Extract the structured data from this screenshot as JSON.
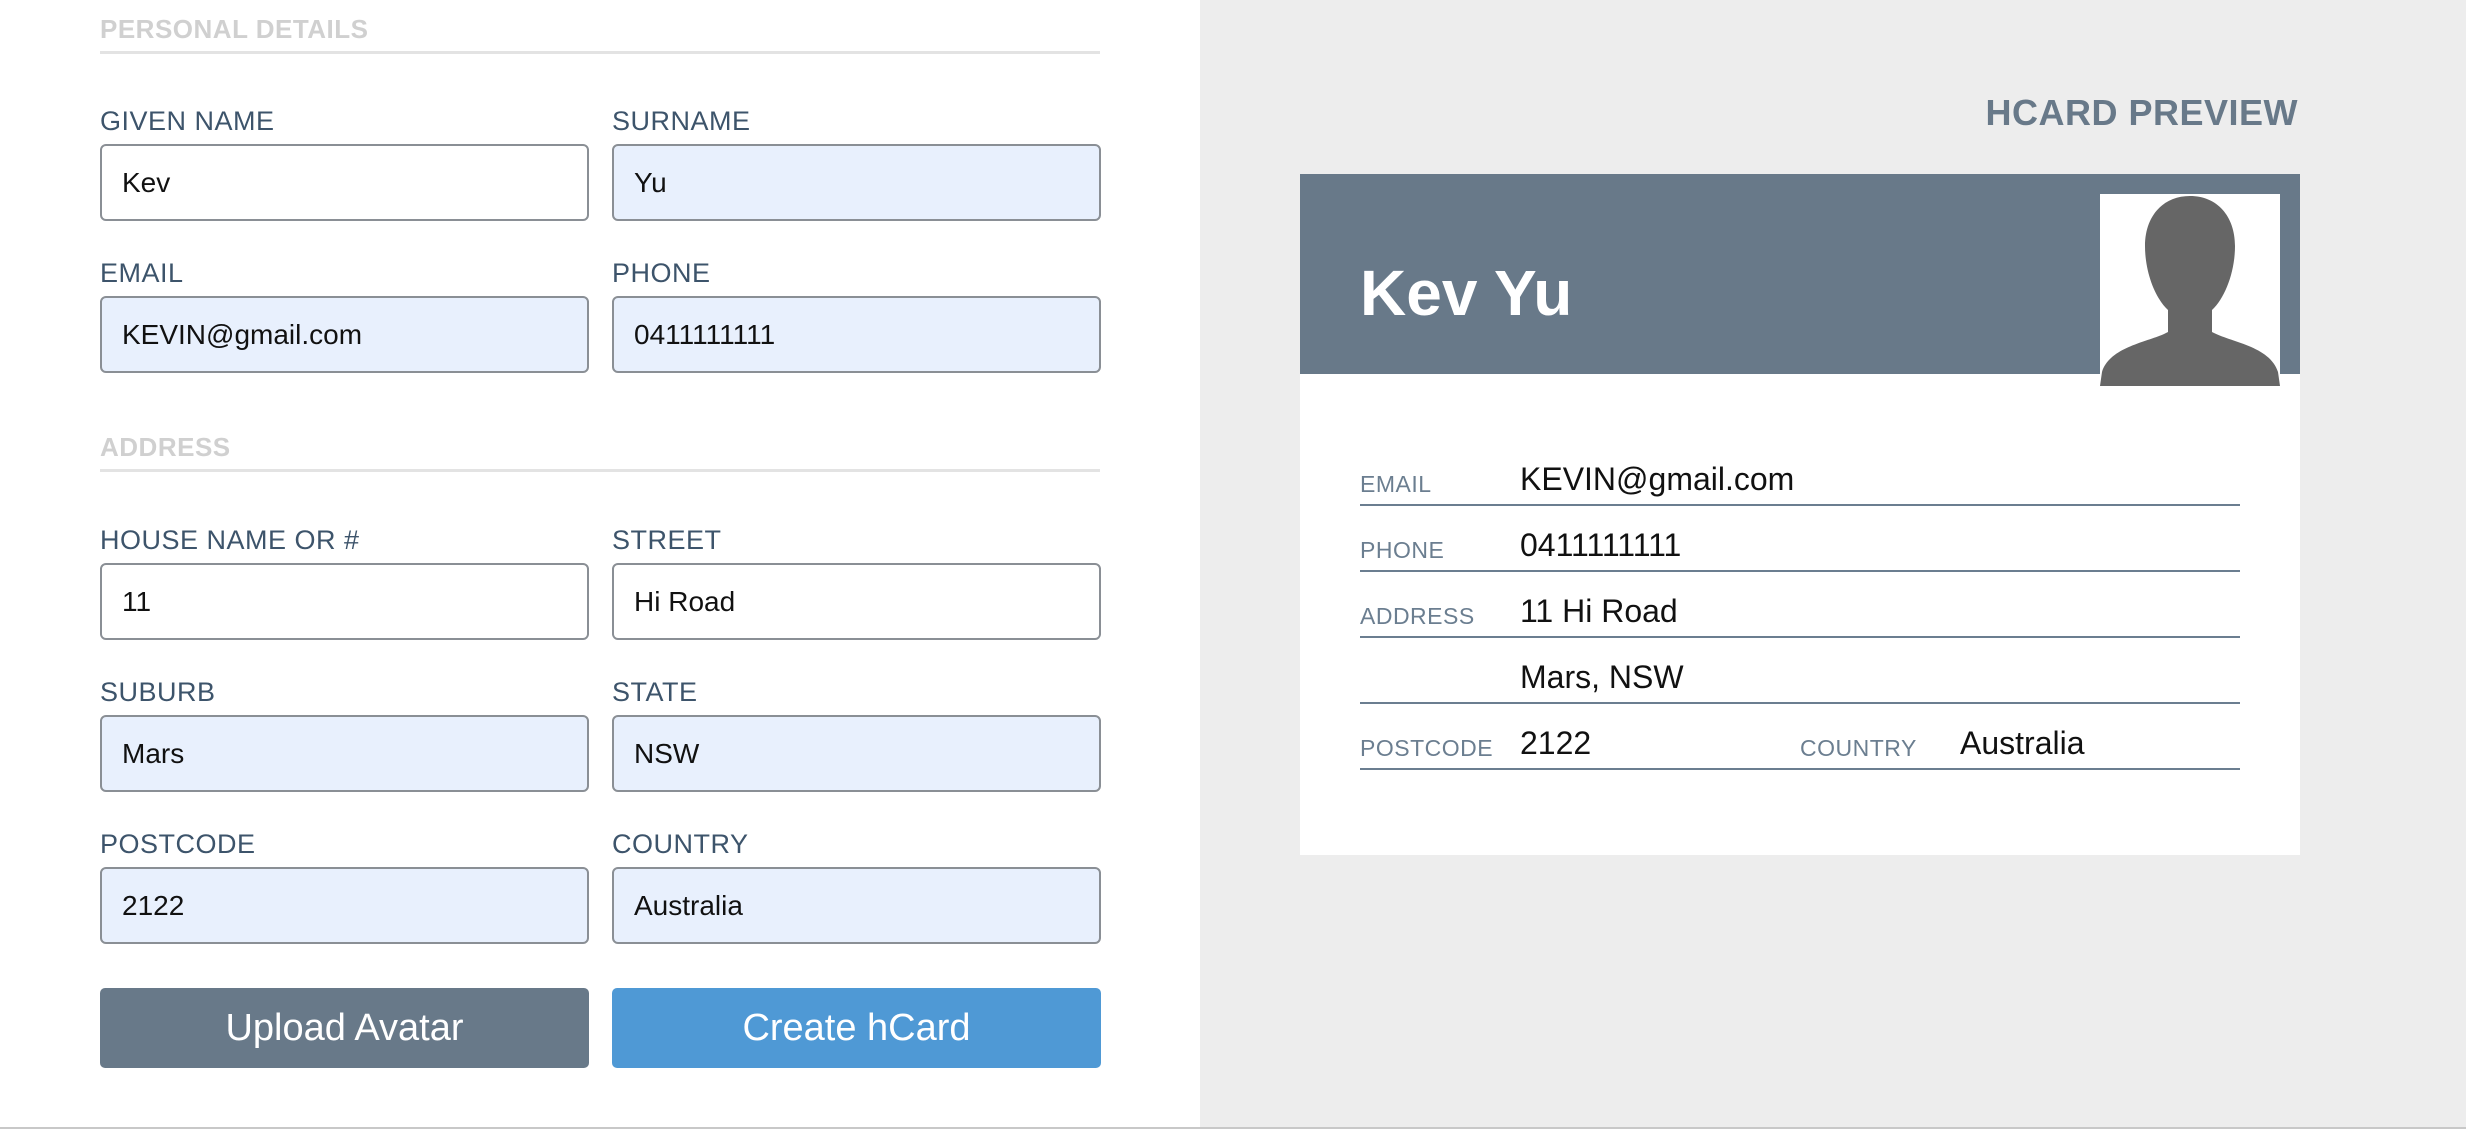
{
  "form": {
    "personal_section_title": "PERSONAL DETAILS",
    "address_section_title": "ADDRESS",
    "fields": {
      "given_name": {
        "label": "GIVEN NAME",
        "value": "Kev"
      },
      "surname": {
        "label": "SURNAME",
        "value": "Yu"
      },
      "email": {
        "label": "EMAIL",
        "value": "KEVIN@gmail.com"
      },
      "phone": {
        "label": "PHONE",
        "value": "0411111111"
      },
      "house": {
        "label": "HOUSE NAME OR #",
        "value": "11"
      },
      "street": {
        "label": "STREET",
        "value": "Hi Road"
      },
      "suburb": {
        "label": "SUBURB",
        "value": "Mars"
      },
      "state": {
        "label": "STATE",
        "value": "NSW"
      },
      "postcode": {
        "label": "POSTCODE",
        "value": "2122"
      },
      "country": {
        "label": "COUNTRY",
        "value": "Australia"
      }
    },
    "upload_button_label": "Upload Avatar",
    "create_button_label": "Create hCard"
  },
  "preview": {
    "heading": "HCARD PREVIEW",
    "name": "Kev Yu",
    "avatar_icon": "person-silhouette-icon",
    "rows": {
      "email": {
        "label": "EMAIL",
        "value": "KEVIN@gmail.com"
      },
      "phone": {
        "label": "PHONE",
        "value": "0411111111"
      },
      "address": {
        "label": "ADDRESS",
        "value": "11 Hi Road"
      },
      "address_line2": {
        "value": "Mars, NSW"
      },
      "postcode": {
        "label": "POSTCODE",
        "value": "2122"
      },
      "country": {
        "label": "COUNTRY",
        "value": "Australia"
      }
    }
  },
  "colors": {
    "header_bg": "#687989",
    "upload_button": "#687989",
    "create_button": "#4f99d5",
    "label_text": "#3d546b",
    "input_autofill_bg": "#e8f0fd",
    "preview_bg": "#ededed"
  }
}
